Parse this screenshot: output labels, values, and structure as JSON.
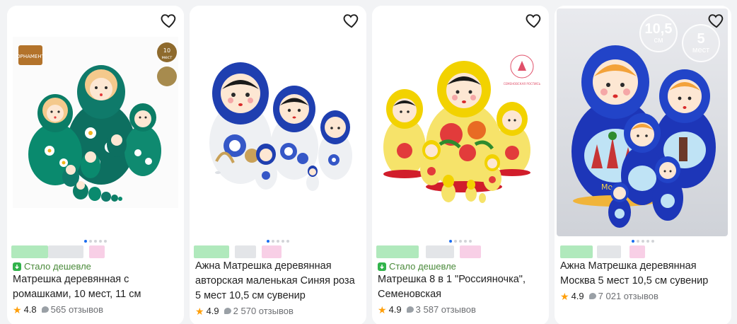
{
  "products": [
    {
      "title": "Матрешка деревянная с ромашками, 10 мест, 11 см",
      "badge": "Стало дешевле",
      "rating": "4.8",
      "reviews": "565 отзывов",
      "image_label": "ОРНАМЕНТ",
      "image_tag_1": "10",
      "image_tag_1_sub": "мест",
      "image_tag_2": "ручная работа"
    },
    {
      "title": "Ажна Матрешка деревянная авторская маленькая Синяя роза 5 мест 10,5 см сувенир",
      "badge": "",
      "rating": "4.9",
      "reviews": "2 570 отзывов"
    },
    {
      "title": "Матрешка 8 в 1 \"Россияночка\", Семеновская",
      "badge": "Стало дешевле",
      "rating": "4.9",
      "reviews": "3 587 отзывов",
      "image_label": "СЕМЕНОВСКАЯ РОСПИСЬ"
    },
    {
      "title": "Ажна Матрешка деревянная Москва 5 мест 10,5 см сувенир",
      "badge": "",
      "rating": "4.9",
      "reviews": "7 021 отзывов",
      "size_value": "10,5",
      "size_unit": "см",
      "count_value": "5",
      "count_unit": "мест",
      "image_label": "Москва"
    }
  ],
  "colors": {
    "accent": "#1b6df0",
    "badge_green": "#31b34b",
    "star": "#ff9f0a",
    "card_bg": "#ffffff",
    "page_bg": "#f2f3f5"
  },
  "icons": {
    "favorite": "heart-outline-icon",
    "rating": "star-icon",
    "reviews": "speech-bubble-icon",
    "badge": "price-down-icon"
  }
}
